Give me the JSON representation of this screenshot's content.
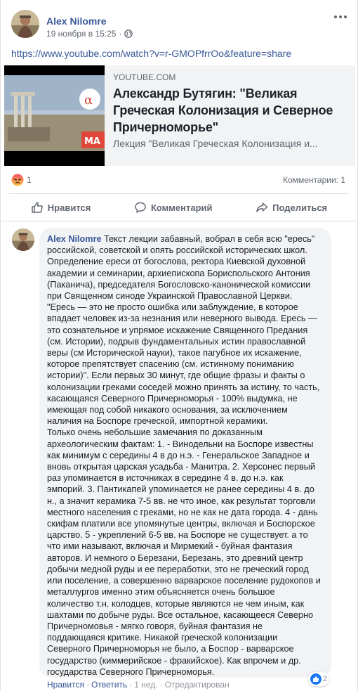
{
  "post": {
    "author": "Alex Nilomre",
    "date": "19 ноября в 15:25",
    "link": "https://www.youtube.com/watch?v=r-GMOPfrrOo&feature=share",
    "preview": {
      "domain": "YOUTUBE.COM",
      "title": "Александр Бутягин: \"Великая Греческая Колонизация и Северное Причерноморье\"",
      "description": "Лекция \"Великая Греческая Колонизация и..."
    },
    "reaction_count": "1",
    "comments_label": "Комментарии: 1",
    "actions": {
      "like": "Нравится",
      "comment": "Комментарий",
      "share": "Поделиться"
    }
  },
  "comment": {
    "author": "Alex Nilomre",
    "text": "Текст лекции забавный, вобрал в себя всю \"ересь\" российской, советской и опять российской исторических школ.\nОпределение ереси от богослова, ректора Киевской духовной академии и семинарии, архиепископа Бориспольского Антония (Паканича), председателя Богословско-канонической комиссии при Священном синоде Украинской Православной Церкви.\n\"Ересь — это не просто ошибка или заблуждение, в которое впадает человек из-за незнания или неверного вывода. Ересь — это сознательное и упрямое искажение Священного Предания (см. Истории), подрыв фундаментальных истин православной веры (см Исторической науки), такое пагубное их искажение, которое препятствует спасению (см. истинному пониманию истории)\". Если первых 30 минут, где общие фразы и факты о колонизации греками соседей можно принять за истину, то часть, касающаяся Северного Причерноморья - 100% выдумка, не имеющая под собой никакого основания, за исключением наличия на Боспоре греческой, импортной керамики.\nТолько очень небольшие замечания по доказанным археологическим фактам: 1. - Винодельни на Боспоре известны как минимум с середины 4 в до н.э. - Генеральское Западное и вновь открытая царская усадьба - Манитра. 2. Херсонес первый раз упоминается в источниках в середине 4 в. до н.э. как эмпорий. 3. Пантикапей упоминается не ранее середины 4 в. до н., а значит керамика 7-5 вв. не что иное, как результат торговли местного населения с греками, но не как не дата города. 4 - дань скифам платили все упомянутые центры, включая и Боспорское царство. 5 - укреплений 6-5 вв. на Боспоре не существует. а то что ими называют, включая и Мирмекий - буйная фантазия авторов. И немного о Березани, Березань, это древний центр добычи медной руды и ее переработки, это не греческий город или поселение, а совершенно варварское поселение рудокопов и металлургов именно этим объясняется очень большое количество т.н. колодцев, которые являются не чем иным, как шахтами по добыче руды. Все остальное, касающееся Северно Причерномовья - мягко говоря, буйная фантазия не поддающаяся критике. Никакой греческой колонизации Северного Причерноморья не было, а Боспор - варварское государство (киммерийское - фракийское). Как впрочем и др. государства Северного Причерноморья.",
    "reaction_count": "2",
    "actions": {
      "like": "Нравится",
      "reply": "Ответить",
      "age": "1 нед.",
      "edited": "Отредактирован",
      "sep": "·"
    }
  },
  "colors": {
    "link": "#385898",
    "secondary": "#606770",
    "like_blue": "#1877f2",
    "angry": "#f0a040"
  }
}
